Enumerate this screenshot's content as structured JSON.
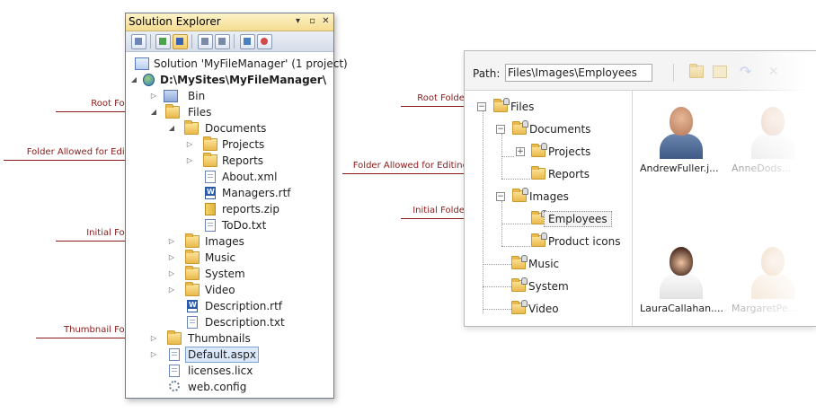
{
  "callouts_left": {
    "root": "Root Folder",
    "editing": "Folder Allowed for Editing",
    "initial": "Initial Folder",
    "thumbnail": "Thumbnail Folder"
  },
  "callouts_right": {
    "root": "Root Folder",
    "editing": "Folder Allowed for Editing",
    "initial": "Initial Folder"
  },
  "solution_explorer": {
    "title": "Solution Explorer",
    "items": [
      "Solution 'MyFileManager' (1 project)",
      "D:\\MySites\\MyFileManager\\",
      "Bin",
      "Files",
      "Documents",
      "Projects",
      "Reports",
      "About.xml",
      "Managers.rtf",
      "reports.zip",
      "ToDo.txt",
      "Images",
      "Music",
      "System",
      "Video",
      "Description.rtf",
      "Description.txt",
      "Thumbnails",
      "Default.aspx",
      "licenses.licx",
      "web.config"
    ]
  },
  "file_manager": {
    "path_label": "Path:",
    "path_value": "Files\\Images\\Employees",
    "tree": [
      "Files",
      "Documents",
      "Projects",
      "Reports",
      "Images",
      "Employees",
      "Product icons",
      "Music",
      "System",
      "Video"
    ],
    "thumbnails": [
      "AndrewFuller.j...",
      "AnneDods...",
      "LauraCallahan....",
      "MargaretPe..."
    ]
  }
}
